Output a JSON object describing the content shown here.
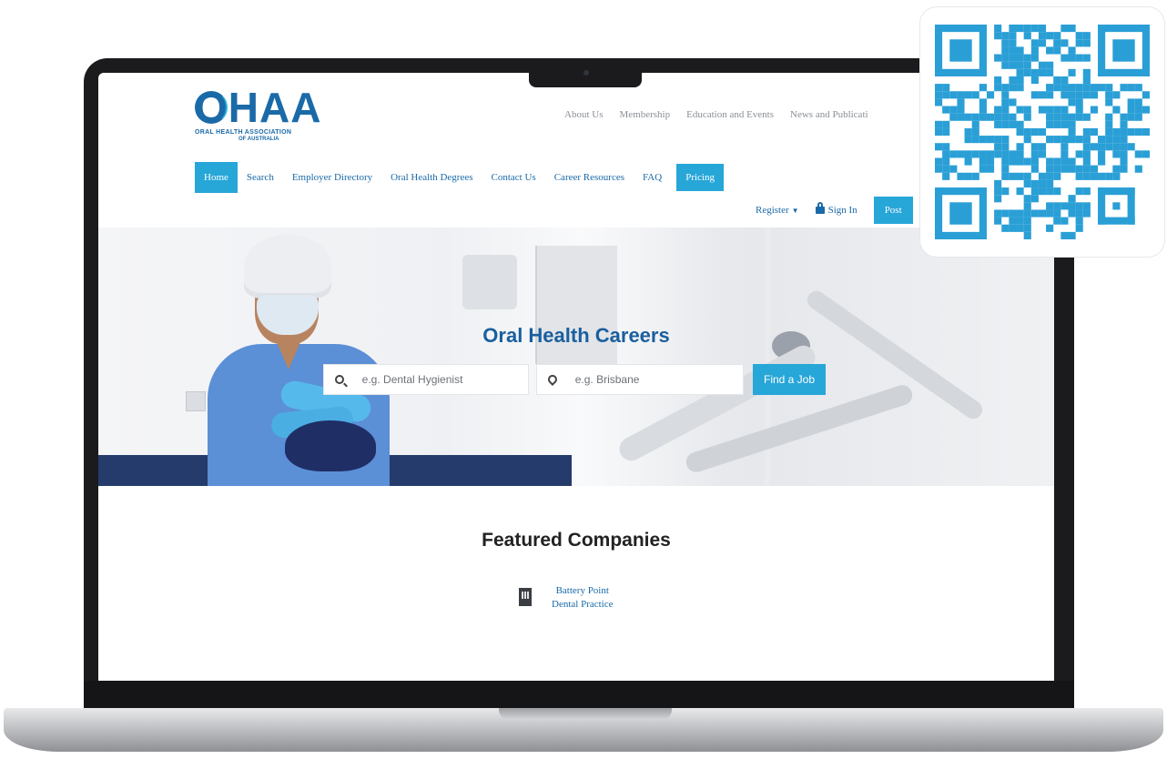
{
  "brand": {
    "logo_text": "OHAA",
    "logo_tagline_1": "ORAL HEALTH ASSOCIATION",
    "logo_tagline_2": "OF AUSTRALIA",
    "accent_color": "#27a6d8",
    "primary_color": "#1a6aa8"
  },
  "top_nav": {
    "items": [
      "About Us",
      "Membership",
      "Education and Events",
      "News and Publicati"
    ]
  },
  "main_nav": {
    "items": [
      "Home",
      "Search",
      "Employer Directory",
      "Oral Health Degrees",
      "Contact Us",
      "Career Resources",
      "FAQ",
      "Pricing"
    ],
    "active": "Home"
  },
  "account_bar": {
    "register": "Register",
    "sign_in": "Sign In",
    "post": "Post"
  },
  "hero": {
    "title": "Oral Health Careers",
    "what_placeholder": "e.g. Dental Hygienist",
    "where_placeholder": "e.g. Brisbane",
    "find_button": "Find a Job"
  },
  "featured": {
    "title": "Featured Companies",
    "companies": [
      {
        "name_line1": "Battery Point",
        "name_line2": "Dental Practice",
        "icon": "building-icon"
      }
    ]
  },
  "qr": {
    "color": "#2a9fd6",
    "icon": "qr-code-icon"
  }
}
